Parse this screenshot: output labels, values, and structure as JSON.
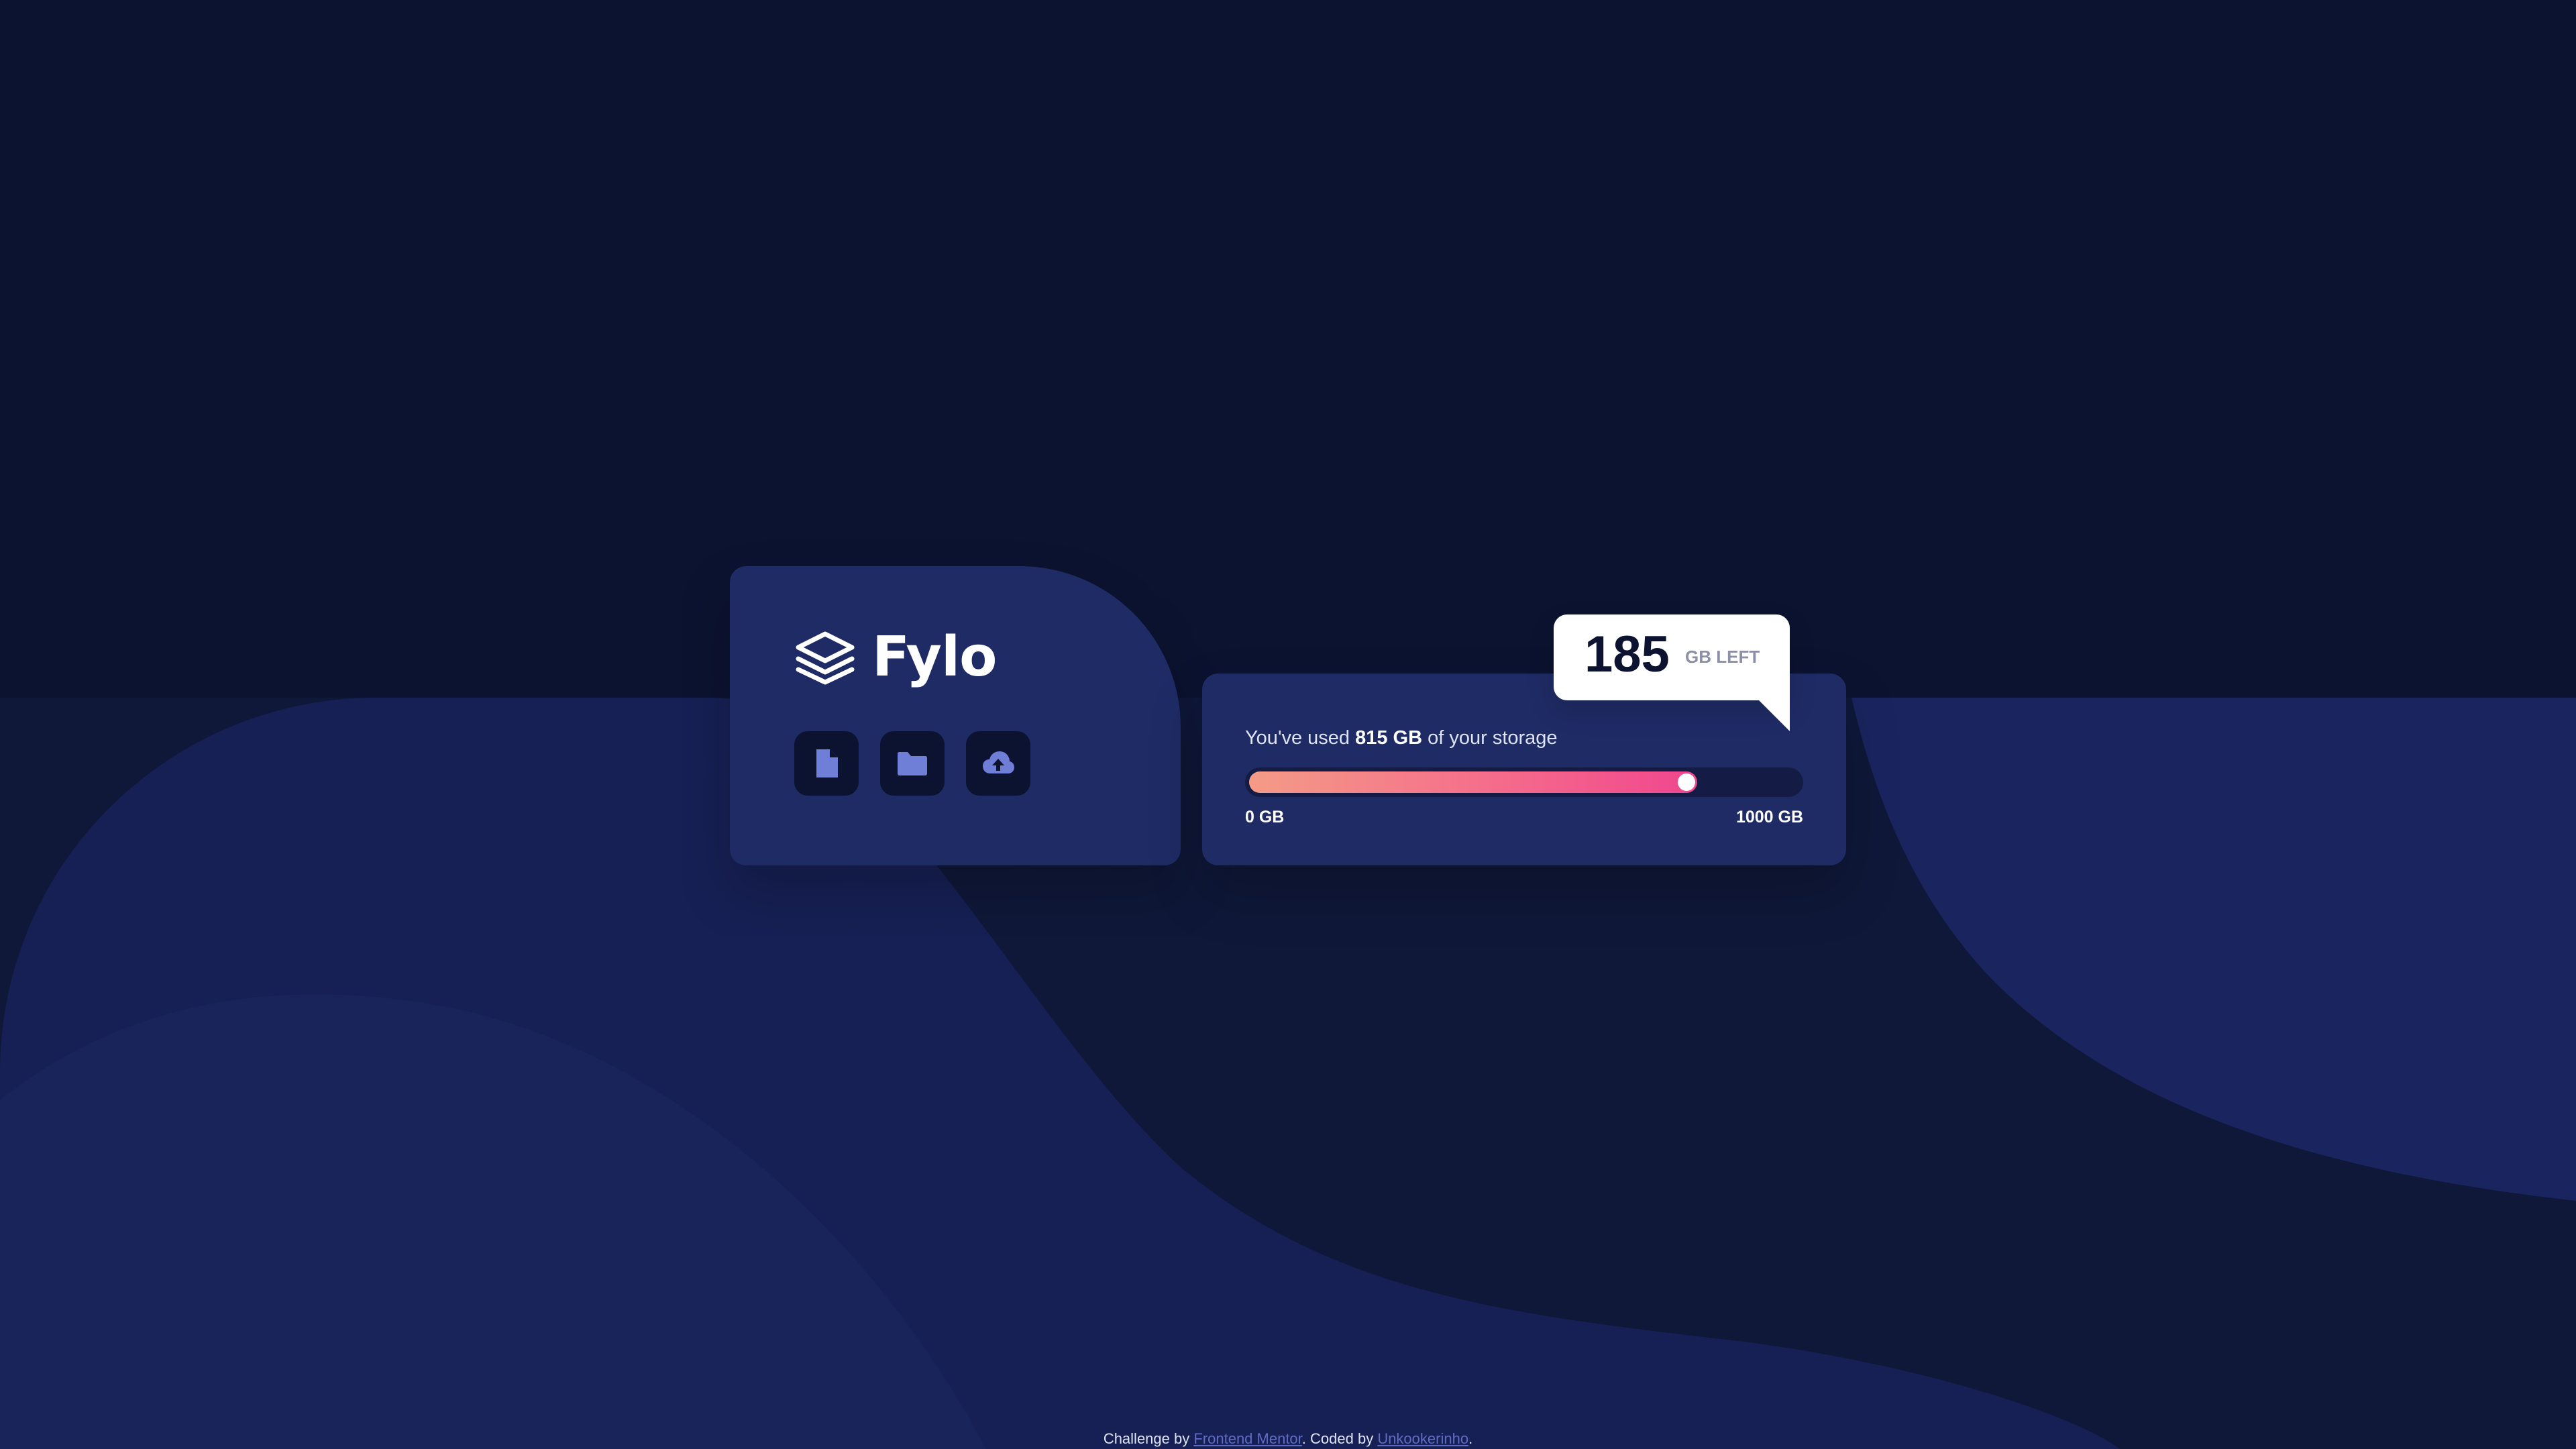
{
  "colors": {
    "page_background": "#0c1330",
    "card_background": "#1f2b65",
    "icon_tile_background": "#0c1330",
    "icon_color": "#6f7ed6",
    "gradient_start": "#f49b87",
    "gradient_end": "#f0468e",
    "bubble_background": "#ffffff",
    "link_color": "#5e6cc4"
  },
  "brand": {
    "name": "Fylo",
    "icon": "layered-stack-logo-icon"
  },
  "toolbar": {
    "buttons": [
      {
        "icon": "document-icon"
      },
      {
        "icon": "folder-icon"
      },
      {
        "icon": "cloud-upload-icon"
      }
    ]
  },
  "storage": {
    "text_prefix": "You've used ",
    "used_amount": "815 GB",
    "text_suffix": " of your storage",
    "used_value": 815,
    "total_value": 1000,
    "scale_min": "0 GB",
    "scale_max": "1000 GB",
    "remaining_value": "185",
    "remaining_unit": "GB LEFT"
  },
  "footer": {
    "prefix": "Challenge by ",
    "link1": "Frontend Mentor",
    "middle": ". Coded by ",
    "link2": "Unkookerinho",
    "suffix": "."
  }
}
